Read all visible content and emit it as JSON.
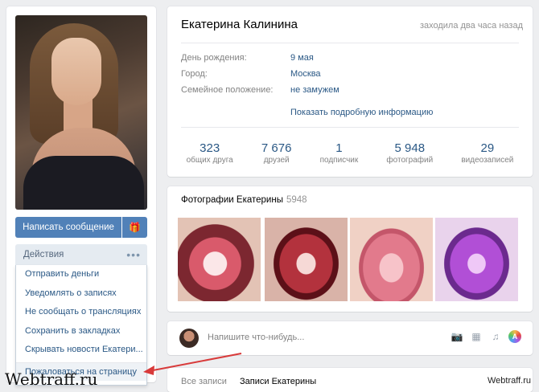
{
  "profile": {
    "name": "Екатерина Калинина",
    "last_seen": "заходила два часа назад",
    "info": [
      {
        "label": "День рождения:",
        "value": "9 мая"
      },
      {
        "label": "Город:",
        "value": "Москва"
      },
      {
        "label": "Семейное положение:",
        "value": "не замужем"
      }
    ],
    "more_info_link": "Показать подробную информацию",
    "counters": [
      {
        "num": "323",
        "label": "общих друга"
      },
      {
        "num": "7 676",
        "label": "друзей"
      },
      {
        "num": "1",
        "label": "подписчик"
      },
      {
        "num": "5 948",
        "label": "фотографий"
      },
      {
        "num": "29",
        "label": "видеозаписей"
      }
    ]
  },
  "sidebar": {
    "message_button": "Написать сообщение",
    "gift_icon": "gift-icon",
    "actions_label": "Действия",
    "actions_dots": "•••",
    "menu": [
      "Отправить деньги",
      "Уведомлять о записях",
      "Не сообщать о трансляциях",
      "Сохранить в закладках",
      "Скрывать новости Екатери...",
      "Пожаловаться на страницу"
    ]
  },
  "photos": {
    "title": "Фотографии Екатерины",
    "count": "5948"
  },
  "post": {
    "placeholder": "Напишите что-нибудь...",
    "icons": [
      "camera-icon",
      "video-icon",
      "music-icon",
      "color-icon"
    ]
  },
  "wall": {
    "tabs": [
      "Все записи",
      "Записи Екатерины"
    ]
  },
  "watermark": {
    "left": "Webtraff.ru",
    "right": "Webtraff.ru"
  },
  "colors": {
    "accent": "#5181b8",
    "link": "#2a5885",
    "arrow": "#d83a3a"
  }
}
